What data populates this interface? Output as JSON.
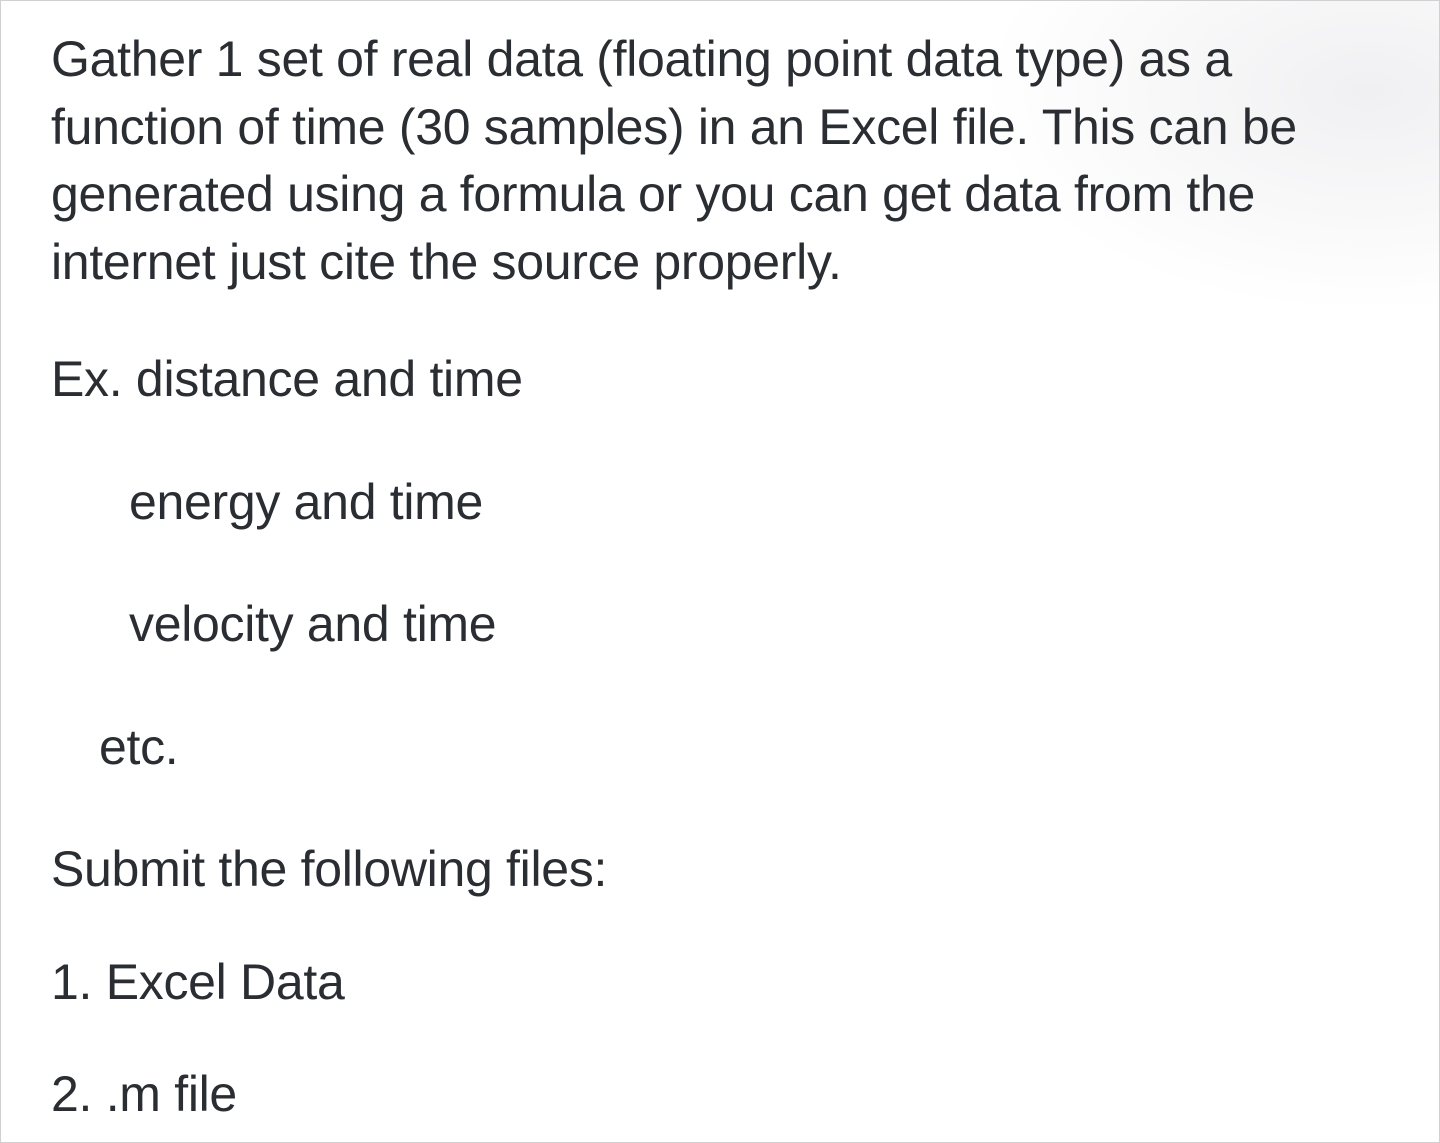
{
  "content": {
    "paragraph_main": "Gather 1 set of real data (floating point data type) as a function of time (30 samples)  in an Excel file. This can be generated using a formula or you can get data from the internet just cite the source properly.",
    "example_prefix": "Ex. distance and time",
    "example_item_1": "energy and time",
    "example_item_2": "velocity and time",
    "example_etc": "etc.",
    "submit_heading": "Submit the following files:",
    "submit_item_1": "1. Excel Data",
    "submit_item_2": "2. .m file"
  }
}
